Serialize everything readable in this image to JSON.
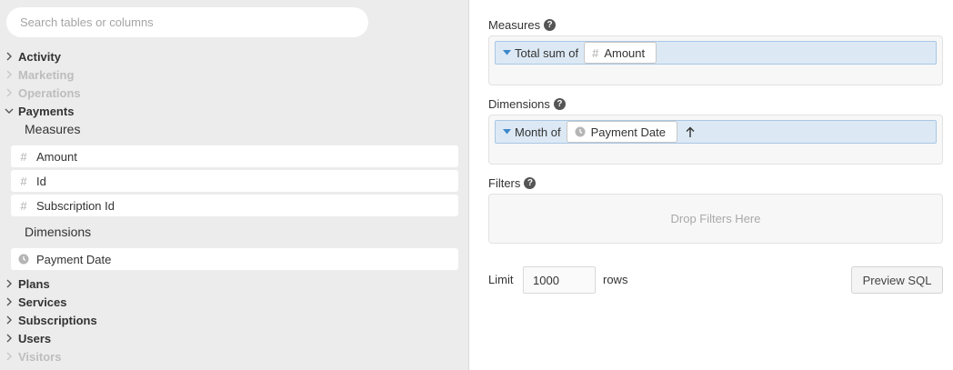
{
  "search": {
    "placeholder": "Search tables or columns"
  },
  "tree": {
    "activity": "Activity",
    "marketing": "Marketing",
    "operations": "Operations",
    "payments": "Payments",
    "plans": "Plans",
    "services": "Services",
    "subscriptions": "Subscriptions",
    "users": "Users",
    "visitors": "Visitors"
  },
  "payments": {
    "measures_label": "Measures",
    "dimensions_label": "Dimensions",
    "measures": [
      "Amount",
      "Id",
      "Subscription Id"
    ],
    "dimensions": [
      "Payment Date"
    ]
  },
  "query": {
    "measures_label": "Measures",
    "measure_agg": "Total sum of",
    "measure_field": "Amount",
    "dimensions_label": "Dimensions",
    "dimension_agg": "Month of",
    "dimension_field": "Payment Date",
    "filters_label": "Filters",
    "filters_placeholder": "Drop Filters Here",
    "help_glyph": "?"
  },
  "limit": {
    "label": "Limit",
    "value": "1000",
    "suffix": "rows"
  },
  "actions": {
    "preview_sql": "Preview SQL"
  },
  "icons": {
    "measure": "#",
    "dimension": "clock-icon"
  },
  "colors": {
    "pill_bg": "#dce9f5",
    "pill_border": "#a9c7e3",
    "panel_bg": "#ececec"
  }
}
